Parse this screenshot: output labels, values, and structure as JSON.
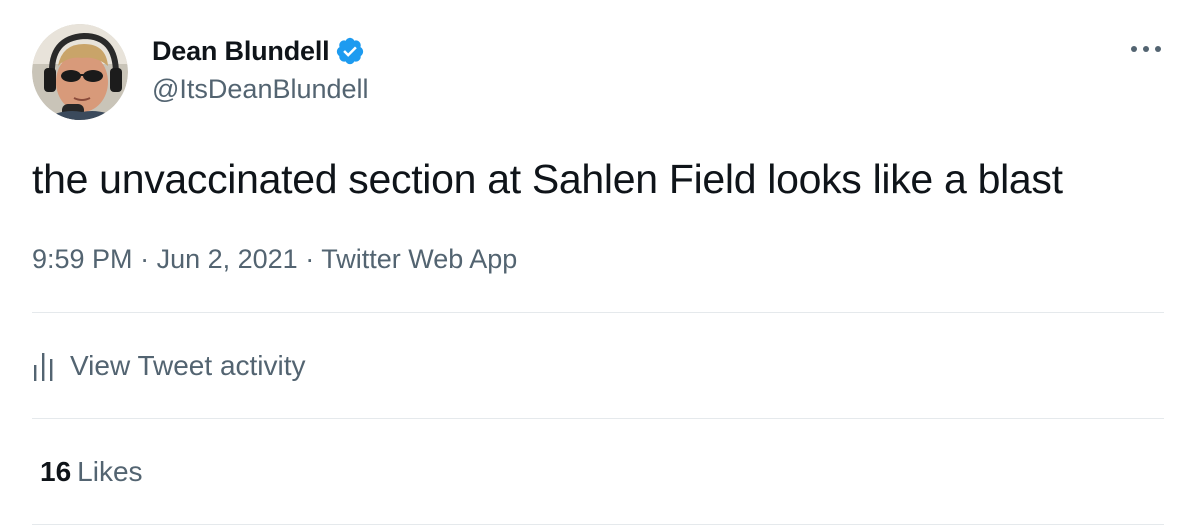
{
  "author": {
    "display_name": "Dean Blundell",
    "handle": "@ItsDeanBlundell",
    "verified": true,
    "avatar_icon": "avatar-photo"
  },
  "tweet": {
    "text": "the unvaccinated section at Sahlen Field looks like a blast",
    "time": "9:59 PM",
    "date": "Jun 2, 2021",
    "source": "Twitter Web App",
    "separator": "·"
  },
  "actions": {
    "more_icon": "more-horizontal-icon",
    "activity_icon": "bar-chart-icon",
    "activity_label": "View Tweet activity"
  },
  "stats": {
    "likes_count": "16",
    "likes_label": "Likes"
  },
  "colors": {
    "text_primary": "#0f1419",
    "text_secondary": "#536471",
    "verified_blue": "#1d9bf0",
    "divider": "#e5e9ec"
  }
}
